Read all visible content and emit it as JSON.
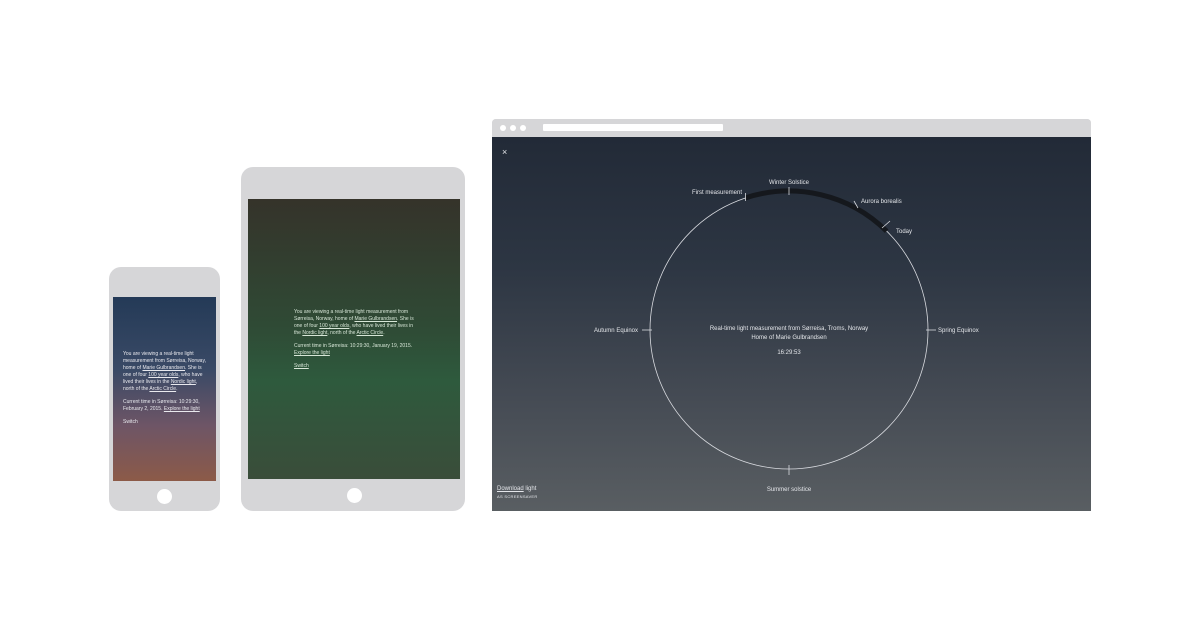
{
  "phone": {
    "intro_1": "You are viewing a real-time light measurement from Sørreisa, Norway, home of ",
    "link_person": "Marie Gulbrandsen",
    "intro_2": ". She is one of four ",
    "link_olds": "100 year olds",
    "intro_3": ", who have lived their lives in the ",
    "link_light": "Nordic light",
    "intro_4": ", north of the ",
    "link_circle": "Arctic Circle",
    "intro_5": ".",
    "time_text": "Current time in Sørreisa: 10:29:30, February 2, 2015. ",
    "link_explore": "Explore the light",
    "switch_label": "Switch"
  },
  "tablet": {
    "intro_1": "You are viewing a real-time light measurement from Sørreisa, Norway, home of ",
    "link_person": "Marie Gulbrandsen",
    "intro_2": ". She is one of four ",
    "link_olds": "100 year olds",
    "intro_3": ", who have lived their lives in the ",
    "link_light": "Nordic light",
    "intro_4": ", north of the ",
    "link_circle": "Arctic Circle",
    "intro_5": ".",
    "time_text": "Current time in Sørreisa: 10:29:30, January 19, 2015. ",
    "link_explore": "Explore the light",
    "switch_label": "Switch"
  },
  "browser": {
    "close_symbol": "×",
    "labels": {
      "winter_solstice": "Winter Solstice",
      "first_measurement": "First measurement",
      "aurora_borealis": "Aurora borealis",
      "today": "Today",
      "autumn_equinox": "Autumn Equinox",
      "spring_equinox": "Spring Equinox",
      "summer_solstice": "Summer solstice"
    },
    "center_line1": "Real-time light measurement from Sørreisa, Troms, Norway",
    "center_line2": "Home of Marie Gulbrandsen",
    "clock": "16:29:53",
    "download_link": "Download",
    "download_rest": " light",
    "download_sub": "AS SCREENSAVER"
  },
  "colors": {
    "browser_top": "#222a37",
    "browser_bottom": "#595e62",
    "tablet_mid": "#2e5a3d",
    "phone_top": "#243a57",
    "phone_bottom": "#8c5a48"
  }
}
